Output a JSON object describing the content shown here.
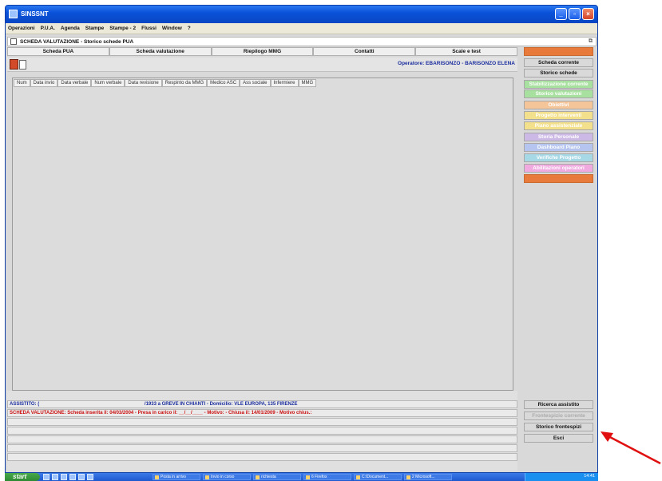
{
  "window": {
    "title": "SINSSNT"
  },
  "menu": [
    "Operazioni",
    "P.U.A.",
    "Agenda",
    "Stampe",
    "Stampe - 2",
    "Flussi",
    "Window",
    "?"
  ],
  "inner_window": {
    "title": "SCHEDA VALUTAZIONE - Storico schede PUA"
  },
  "tabs": [
    "Scheda PUA",
    "Scheda valutazione",
    "Riepilogo MMG",
    "Contatti",
    "Scale e test"
  ],
  "operator": "Operatore: EBARISONZO - BARISONZO ELENA",
  "table_columns": [
    "Num",
    "Data invio",
    "Data verbale",
    "Num verbale",
    "Data revisione",
    "Respinto da MMG",
    "Medico ASC",
    "Ass sociale",
    "Infermiere",
    "MMG"
  ],
  "right_buttons": [
    {
      "label": "Scheda corrente",
      "color": "#eeeeee",
      "text_color": "#111111"
    },
    {
      "label": "Storico schede",
      "color": "#eeeeee",
      "text_color": "#111111"
    },
    {
      "label": "Stabilizzazione corrente",
      "color": "#a8e0a0",
      "text_color": "#ffffff"
    },
    {
      "label": "Storico valutazioni",
      "color": "#a8e0a0",
      "text_color": "#ffffff"
    },
    {
      "label": "Obiettivi",
      "color": "#f5c59a",
      "text_color": "#ffffff"
    },
    {
      "label": "Progetto interventi",
      "color": "#f3e08c",
      "text_color": "#ffffff"
    },
    {
      "label": "Piano assistenziale",
      "color": "#f3e08c",
      "text_color": "#ffffff"
    },
    {
      "label": "Storia Personale",
      "color": "#cdb9e6",
      "text_color": "#ffffff"
    },
    {
      "label": "Dashboard Piano",
      "color": "#b5c5f0",
      "text_color": "#ffffff"
    },
    {
      "label": "Verifiche Progetto",
      "color": "#a6d8e6",
      "text_color": "#ffffff"
    },
    {
      "label": "Abilitazioni operatori",
      "color": "#f0aae0",
      "text_color": "#ffffff"
    }
  ],
  "bottom_buttons": [
    "Ricerca assistito",
    "Frontespizio corrente",
    "Storico frontespizi",
    "Esci"
  ],
  "status": {
    "assistito_label": "ASSISTITO: (",
    "assistito_info": "/1933 a GREVE IN CHIANTI - Domicilio: VLE EUROPA, 135 FIRENZE",
    "scheda_line": "SCHEDA VALUTAZIONE: Scheda inserita il: 04/03/2004 - Presa in carico il: __/__/____ - Motivo: - Chiusa il: 14/01/2009 - Motivo chius.:"
  },
  "taskbar": {
    "start": "start",
    "tasks": [
      "Posta in arrivo",
      "Invio in corso",
      "richiesta",
      "6 Firefox",
      "C:\\Document...",
      "2 Microsoft..."
    ],
    "clock": "14:41"
  },
  "colors": {
    "titlebar": "#0a52da",
    "accent_text": "#1a2d9e",
    "error_text": "#cc1111",
    "arrow": "#e01010"
  }
}
